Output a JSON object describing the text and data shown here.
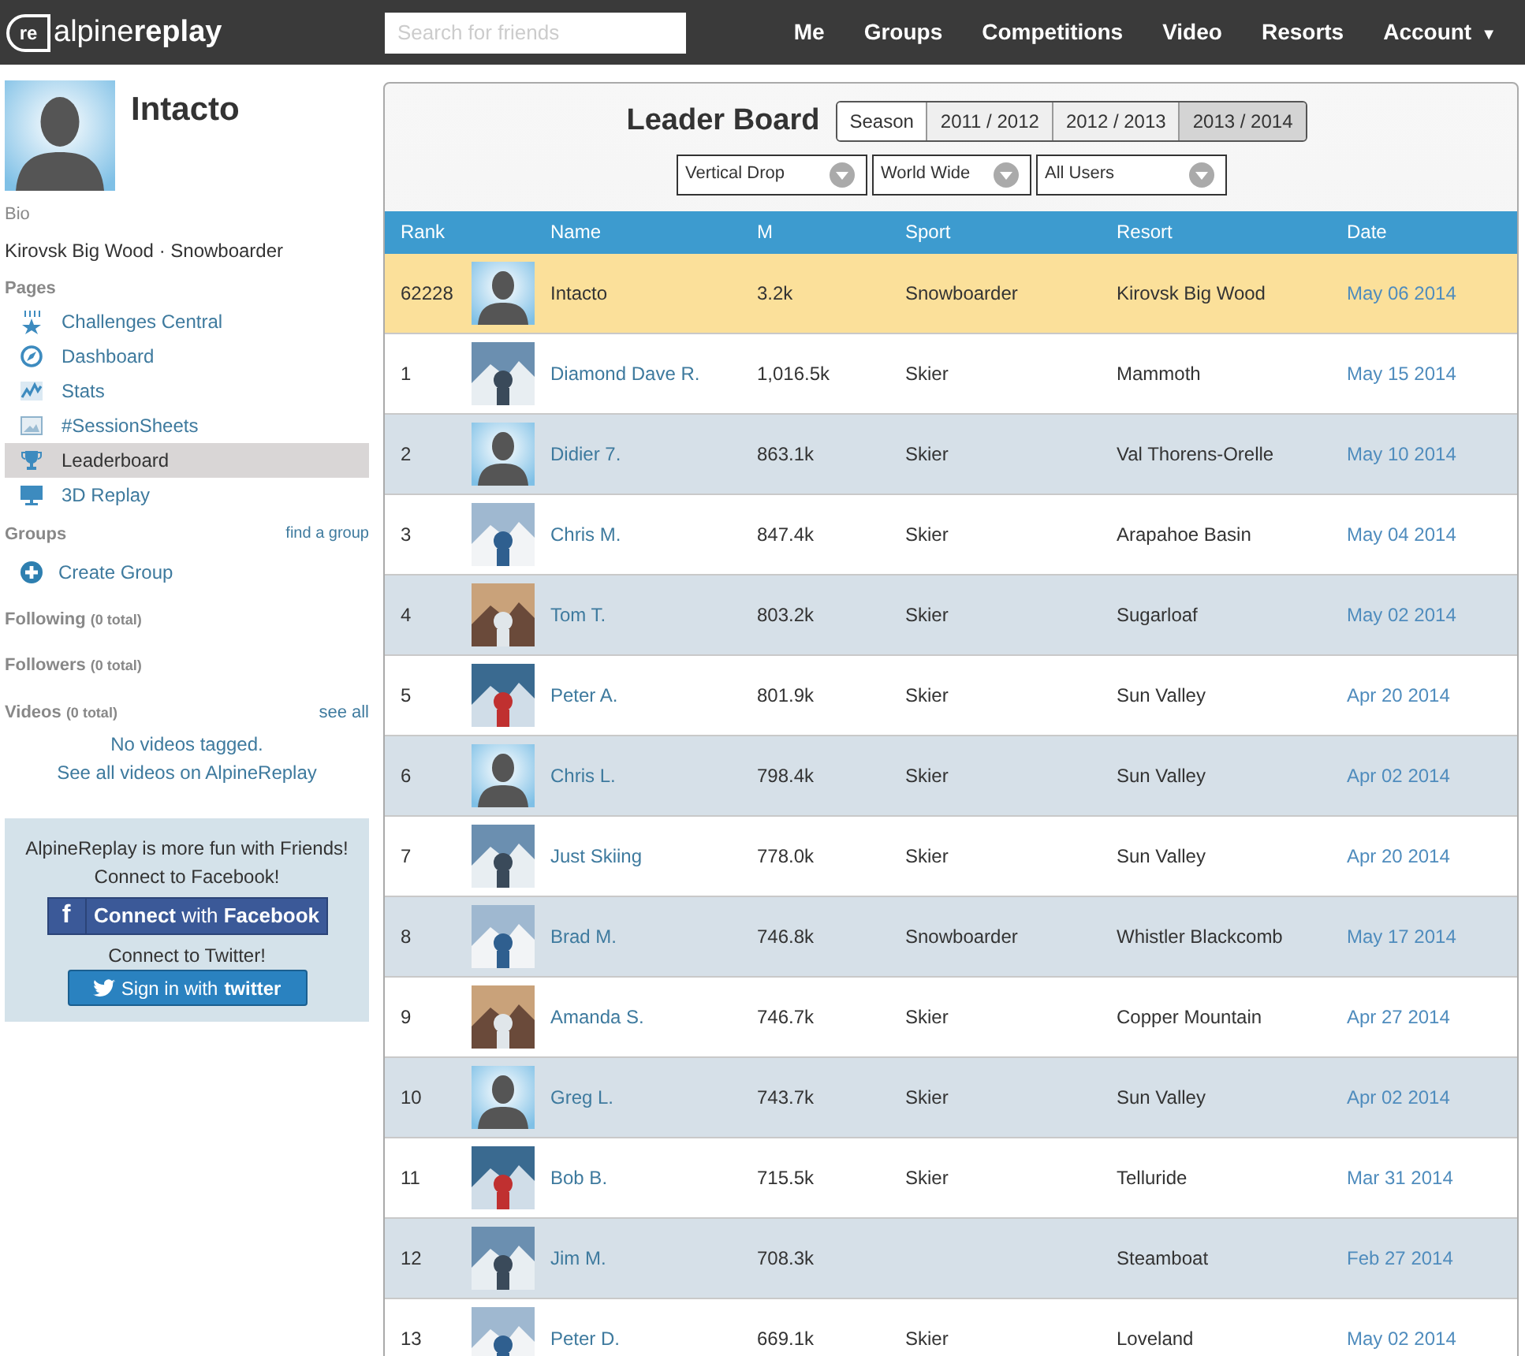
{
  "header": {
    "logo_mark": "re",
    "logo_light": "alpine",
    "logo_bold": "replay",
    "search": {
      "placeholder": "Search for friends"
    },
    "nav": [
      {
        "label": "Me"
      },
      {
        "label": "Groups"
      },
      {
        "label": "Competitions"
      },
      {
        "label": "Video"
      },
      {
        "label": "Resorts"
      },
      {
        "label": "Account",
        "caret": "▼"
      }
    ]
  },
  "profile": {
    "name": "Intacto",
    "bio_label": "Bio",
    "bio": "Kirovsk Big Wood · Snowboarder"
  },
  "pages": {
    "title": "Pages",
    "items": [
      {
        "label": "Challenges Central",
        "selected": false
      },
      {
        "label": "Dashboard",
        "selected": false
      },
      {
        "label": "Stats",
        "selected": false
      },
      {
        "label": "#SessionSheets",
        "selected": false
      },
      {
        "label": "Leaderboard",
        "selected": true
      },
      {
        "label": "3D Replay",
        "selected": false
      }
    ]
  },
  "groups": {
    "title": "Groups",
    "link": "find a group",
    "create": "Create Group"
  },
  "following": {
    "title": "Following",
    "count": "(0 total)"
  },
  "followers": {
    "title": "Followers",
    "count": "(0 total)"
  },
  "videos": {
    "title": "Videos",
    "count": "(0 total)",
    "link": "see all",
    "empty": "No videos tagged.",
    "all_link": "See all videos on AlpineReplay"
  },
  "social": {
    "text_1": "AlpineReplay is more fun with Friends!",
    "text_2": "Connect to Facebook!",
    "facebook_button": {
      "icon": "f",
      "bold_1": "Connect",
      "light": " with ",
      "bold_2": "Facebook"
    },
    "text_3": "Connect to Twitter!",
    "twitter_button": {
      "light": "Sign in with ",
      "bold": "twitter"
    }
  },
  "leaderboard": {
    "title": "Leader Board",
    "seasons": [
      {
        "label": "Season",
        "selected": false
      },
      {
        "label": "2011 / 2012",
        "selected": false
      },
      {
        "label": "2012 / 2013",
        "selected": false
      },
      {
        "label": "2013 / 2014",
        "selected": true
      }
    ],
    "filters": [
      {
        "value": "Vertical Drop"
      },
      {
        "value": "World Wide"
      },
      {
        "value": "All Users"
      }
    ],
    "columns": [
      "Rank",
      "Name",
      "M",
      "Sport",
      "Resort",
      "Date"
    ],
    "rows": [
      {
        "rank": "62228",
        "kind": "avatar",
        "name": "Intacto",
        "m": "3.2k",
        "sport": "Snowboarder",
        "resort": "Kirovsk Big Wood",
        "date": "May 06 2014",
        "highlighted": true
      },
      {
        "rank": "1",
        "kind": "picture",
        "name": "Diamond Dave R.",
        "m": "1,016.5k",
        "sport": "Skier",
        "resort": "Mammoth",
        "date": "May 15 2014",
        "highlighted": false
      },
      {
        "rank": "2",
        "kind": "avatar",
        "name": "Didier 7.",
        "m": "863.1k",
        "sport": "Skier",
        "resort": "Val Thorens-Orelle",
        "date": "May 10 2014",
        "highlighted": false
      },
      {
        "rank": "3",
        "kind": "picture",
        "name": "Chris M.",
        "m": "847.4k",
        "sport": "Skier",
        "resort": "Arapahoe Basin",
        "date": "May 04 2014",
        "highlighted": false
      },
      {
        "rank": "4",
        "kind": "picture",
        "name": "Tom T.",
        "m": "803.2k",
        "sport": "Skier",
        "resort": "Sugarloaf",
        "date": "May 02 2014",
        "highlighted": false
      },
      {
        "rank": "5",
        "kind": "picture",
        "name": "Peter A.",
        "m": "801.9k",
        "sport": "Skier",
        "resort": "Sun Valley",
        "date": "Apr 20 2014",
        "highlighted": false
      },
      {
        "rank": "6",
        "kind": "avatar",
        "name": "Chris L.",
        "m": "798.4k",
        "sport": "Skier",
        "resort": "Sun Valley",
        "date": "Apr 02 2014",
        "highlighted": false
      },
      {
        "rank": "7",
        "kind": "picture",
        "name": "Just Skiing",
        "m": "778.0k",
        "sport": "Skier",
        "resort": "Sun Valley",
        "date": "Apr 20 2014",
        "highlighted": false
      },
      {
        "rank": "8",
        "kind": "picture",
        "name": "Brad M.",
        "m": "746.8k",
        "sport": "Snowboarder",
        "resort": "Whistler Blackcomb",
        "date": "May 17 2014",
        "highlighted": false
      },
      {
        "rank": "9",
        "kind": "picture",
        "name": "Amanda S.",
        "m": "746.7k",
        "sport": "Skier",
        "resort": "Copper Mountain",
        "date": "Apr 27 2014",
        "highlighted": false
      },
      {
        "rank": "10",
        "kind": "avatar",
        "name": "Greg L.",
        "m": "743.7k",
        "sport": "Skier",
        "resort": "Sun Valley",
        "date": "Apr 02 2014",
        "highlighted": false
      },
      {
        "rank": "11",
        "kind": "picture",
        "name": "Bob B.",
        "m": "715.5k",
        "sport": "Skier",
        "resort": "Telluride",
        "date": "Mar 31 2014",
        "highlighted": false
      },
      {
        "rank": "12",
        "kind": "picture",
        "name": "Jim M.",
        "m": "708.3k",
        "resort": "Steamboat",
        "date": "Feb 27 2014",
        "highlighted": false
      },
      {
        "rank": "13",
        "kind": "picture",
        "name": "Peter D.",
        "m": "669.1k",
        "sport": "Skier",
        "resort": "Loveland",
        "date": "May 02 2014",
        "highlighted": false
      }
    ]
  }
}
